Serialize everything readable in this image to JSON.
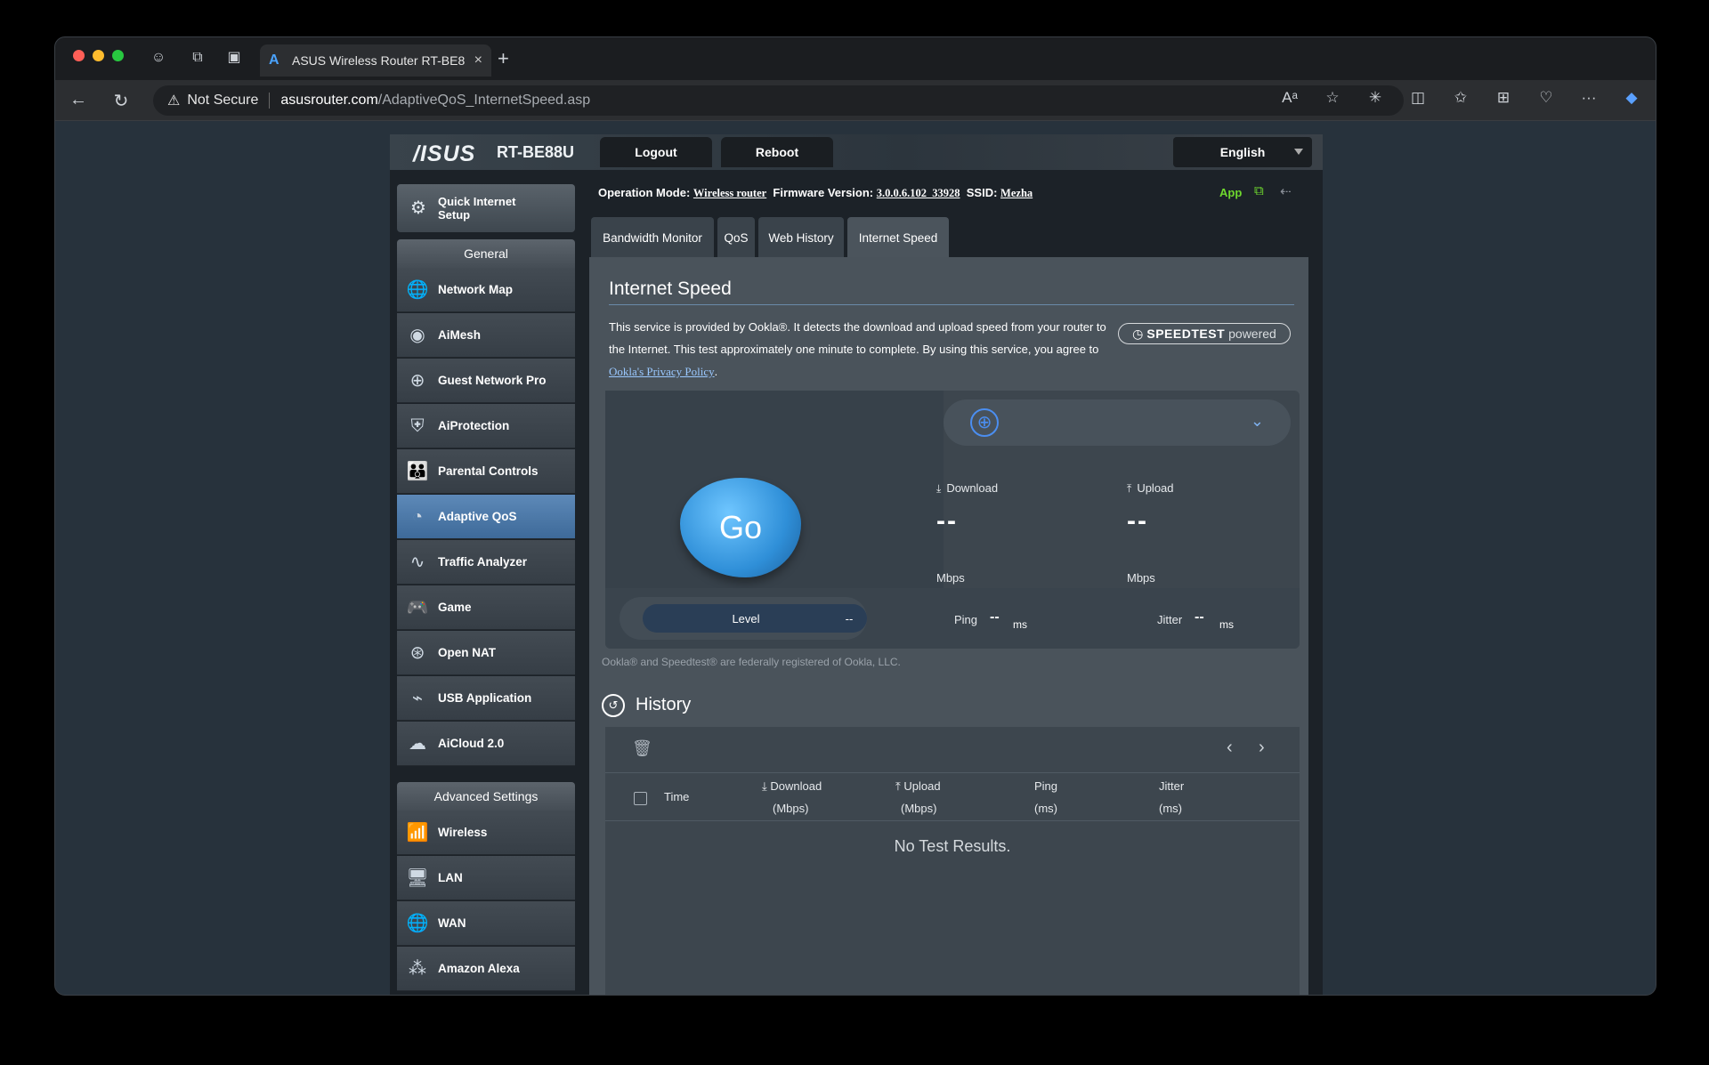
{
  "browser": {
    "tab_title": "ASUS Wireless Router RT-BE8",
    "not_secure": "Not Secure",
    "url_host": "asusrouter.com",
    "url_path": "/AdaptiveQoS_InternetSpeed.asp"
  },
  "header": {
    "logo": "/ISUS",
    "model": "RT-BE88U",
    "logout": "Logout",
    "reboot": "Reboot",
    "language": "English"
  },
  "sidebar": {
    "quick_setup": "Quick Internet Setup",
    "general_title": "General",
    "general_items": [
      {
        "label": "Network Map"
      },
      {
        "label": "AiMesh"
      },
      {
        "label": "Guest Network Pro"
      },
      {
        "label": "AiProtection"
      },
      {
        "label": "Parental Controls"
      },
      {
        "label": "Adaptive QoS"
      },
      {
        "label": "Traffic Analyzer"
      },
      {
        "label": "Game"
      },
      {
        "label": "Open NAT"
      },
      {
        "label": "USB Application"
      },
      {
        "label": "AiCloud 2.0"
      }
    ],
    "advanced_title": "Advanced Settings",
    "advanced_items": [
      {
        "label": "Wireless"
      },
      {
        "label": "LAN"
      },
      {
        "label": "WAN"
      },
      {
        "label": "Amazon Alexa"
      }
    ]
  },
  "status": {
    "opmode_label": "Operation Mode:",
    "opmode_value": "Wireless router",
    "fw_label": "Firmware Version:",
    "fw_value": "3.0.0.6.102_33928",
    "ssid_label": "SSID:",
    "ssid_value": "Mezha",
    "app": "App"
  },
  "tabs": [
    "Bandwidth Monitor",
    "QoS",
    "Web History",
    "Internet Speed"
  ],
  "speed": {
    "title": "Internet Speed",
    "desc": "This service is provided by Ookla®. It detects the download and upload speed from your router to the Internet. This test approximately one minute to complete. By using this service, you agree to ",
    "privacy_link": "Ookla's Privacy Policy",
    "period": ".",
    "badge_speedtest": "SPEEDTEST",
    "badge_powered": "powered",
    "go": "Go",
    "download_label": "Download",
    "upload_label": "Upload",
    "download_value": "--",
    "upload_value": "--",
    "unit": "Mbps",
    "level": "Level",
    "level_value": "--",
    "ping_label": "Ping",
    "ping_value": "--",
    "jitter_label": "Jitter",
    "jitter_value": "--",
    "ms": "ms",
    "trademark": "Ookla® and Speedtest® are federally registered of Ookla, LLC."
  },
  "history": {
    "title": "History",
    "columns": {
      "time": "Time",
      "download": "Download",
      "download_unit": "(Mbps)",
      "upload": "Upload",
      "upload_unit": "(Mbps)",
      "ping": "Ping",
      "ping_unit": "(ms)",
      "jitter": "Jitter",
      "jitter_unit": "(ms)"
    },
    "empty": "No Test Results."
  },
  "colors": {
    "accent": "#4b8ef0",
    "active_menu": "#4f7caa",
    "app_green": "#6fd92e"
  }
}
